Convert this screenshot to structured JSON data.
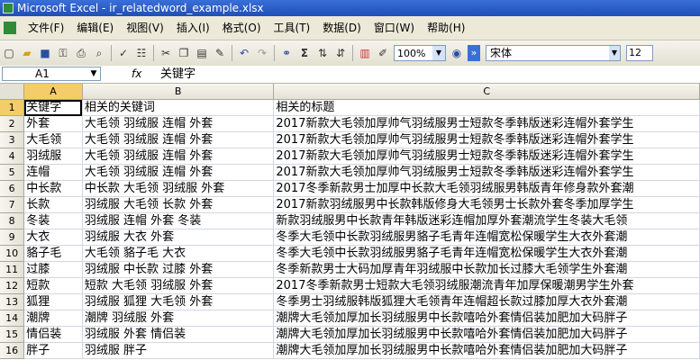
{
  "window": {
    "title": "Microsoft Excel - ir_relatedword_example.xlsx"
  },
  "menu": [
    "文件(F)",
    "编辑(E)",
    "视图(V)",
    "插入(I)",
    "格式(O)",
    "工具(T)",
    "数据(D)",
    "窗口(W)",
    "帮助(H)"
  ],
  "toolbar": {
    "zoom": "100%",
    "font": "宋体",
    "font_size": "12",
    "sigma": "Σ"
  },
  "formula_bar": {
    "name_box": "A1",
    "fx": "fx",
    "content": "关键字"
  },
  "columns": [
    "A",
    "B",
    "C"
  ],
  "rows": [
    {
      "n": "1",
      "a": "关键字",
      "b": "相关的关键词",
      "c": "相关的标题"
    },
    {
      "n": "2",
      "a": "外套",
      "b": "大毛领  羽绒服  连帽  外套",
      "c": "2017新款大毛领加厚帅气羽绒服男士短款冬季韩版迷彩连帽外套学生"
    },
    {
      "n": "3",
      "a": "大毛领",
      "b": "大毛领  羽绒服  连帽  外套",
      "c": "2017新款大毛领加厚帅气羽绒服男士短款冬季韩版迷彩连帽外套学生"
    },
    {
      "n": "4",
      "a": "羽绒服",
      "b": "大毛领  羽绒服  连帽  外套",
      "c": "2017新款大毛领加厚帅气羽绒服男士短款冬季韩版迷彩连帽外套学生"
    },
    {
      "n": "5",
      "a": "连帽",
      "b": "大毛领  羽绒服  连帽  外套",
      "c": "2017新款大毛领加厚帅气羽绒服男士短款冬季韩版迷彩连帽外套学生"
    },
    {
      "n": "6",
      "a": "中长款",
      "b": "中长款  大毛领  羽绒服  外套",
      "c": "2017冬季新款男士加厚中长款大毛领羽绒服男韩版青年修身款外套潮"
    },
    {
      "n": "7",
      "a": "长款",
      "b": "羽绒服  大毛领  长款  外套",
      "c": "2017新款羽绒服男中长款韩版修身大毛领男士长款外套冬季加厚学生"
    },
    {
      "n": "8",
      "a": "冬装",
      "b": "羽绒服  连帽  外套  冬装",
      "c": "新款羽绒服男中长款青年韩版迷彩连帽加厚外套潮流学生冬装大毛领"
    },
    {
      "n": "9",
      "a": "大衣",
      "b": "羽绒服  大衣  外套",
      "c": "冬季大毛领中长款羽绒服男貉子毛青年连帽宽松保暖学生大衣外套潮"
    },
    {
      "n": "10",
      "a": "貉子毛",
      "b": "大毛领  貉子毛  大衣",
      "c": "冬季大毛领中长款羽绒服男貉子毛青年连帽宽松保暖学生大衣外套潮"
    },
    {
      "n": "11",
      "a": "过膝",
      "b": "羽绒服  中长款  过膝  外套",
      "c": "冬季新款男士大码加厚青年羽绒服中长款加长过膝大毛领学生外套潮"
    },
    {
      "n": "12",
      "a": "短款",
      "b": "短款  大毛领  羽绒服  外套",
      "c": "2017冬季新款男士短款大毛领羽绒服潮流青年加厚保暖潮男学生外套"
    },
    {
      "n": "13",
      "a": "狐狸",
      "b": "羽绒服  狐狸  大毛领  外套",
      "c": "冬季男士羽绒服韩版狐狸大毛领青年连帽超长款过膝加厚大衣外套潮"
    },
    {
      "n": "14",
      "a": "潮牌",
      "b": "潮牌  羽绒服  外套",
      "c": "潮牌大毛领加厚加长羽绒服男中长款嘻哈外套情侣装加肥加大码胖子"
    },
    {
      "n": "15",
      "a": "情侣装",
      "b": "羽绒服  外套  情侣装",
      "c": "潮牌大毛领加厚加长羽绒服男中长款嘻哈外套情侣装加肥加大码胖子"
    },
    {
      "n": "16",
      "a": "胖子",
      "b": "羽绒服  胖子",
      "c": "潮牌大毛领加厚加长羽绒服男中长款嘻哈外套情侣装加肥加大码胖子"
    }
  ]
}
